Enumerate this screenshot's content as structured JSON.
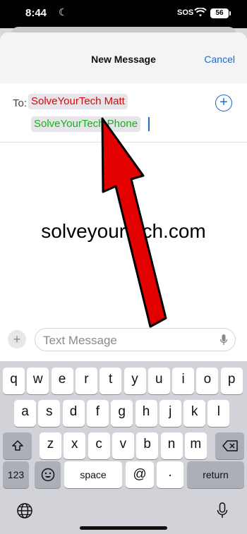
{
  "status_bar": {
    "time": "8:44",
    "sos": "SOS",
    "battery": "56"
  },
  "header": {
    "title": "New Message",
    "cancel": "Cancel"
  },
  "recipients": {
    "to_label": "To:",
    "items": [
      "SolveYourTech Matt",
      "SolveYourTech Phone"
    ]
  },
  "watermark": "solveyourtech.com",
  "composer": {
    "placeholder": "Text Message"
  },
  "keyboard": {
    "row1": [
      "q",
      "w",
      "e",
      "r",
      "t",
      "y",
      "u",
      "i",
      "o",
      "p"
    ],
    "row2": [
      "a",
      "s",
      "d",
      "f",
      "g",
      "h",
      "j",
      "k",
      "l"
    ],
    "row3": [
      "z",
      "x",
      "c",
      "v",
      "b",
      "n",
      "m"
    ],
    "numbers": "123",
    "space": "space",
    "at": "@",
    "dot": ".",
    "return": "return"
  },
  "colors": {
    "accent": "#1a6ad0",
    "recipient_1": "#d10a0a",
    "recipient_2": "#19b019",
    "arrow": "#e30000"
  }
}
